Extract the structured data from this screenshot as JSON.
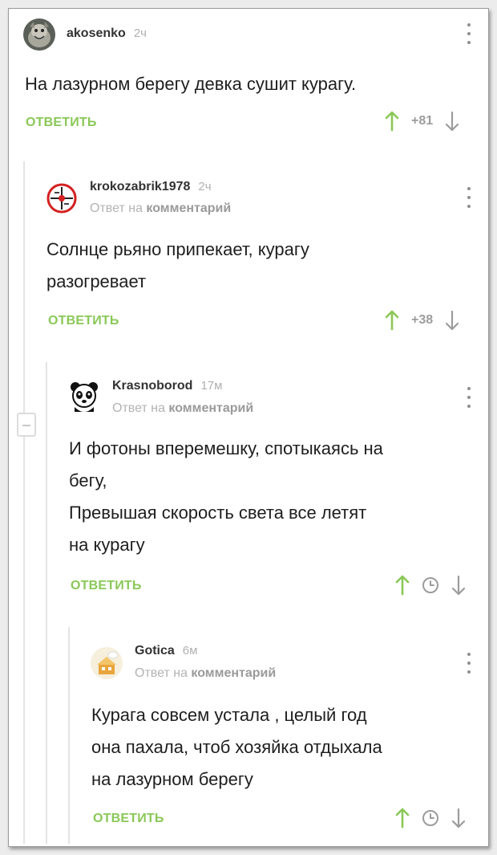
{
  "comments": [
    {
      "username": "akosenko",
      "time": "2ч",
      "text_lines": [
        "На лазурном берегу девка сушит курагу."
      ],
      "reply_label": "ОТВЕТИТЬ",
      "score": "+81"
    },
    {
      "username": "krokozabrik1978",
      "time": "2ч",
      "reply_prefix": "Ответ на",
      "reply_target": "комментарий",
      "text_lines": [
        "Солнце рьяно припекает, курагу",
        "разогревает"
      ],
      "reply_label": "ОТВЕТИТЬ",
      "score": "+38"
    },
    {
      "username": "Krasnoborod",
      "time": "17м",
      "reply_prefix": "Ответ на",
      "reply_target": "комментарий",
      "text_lines": [
        "И фотоны вперемешку, спотыкаясь на",
        "бегу,",
        "Превышая скорость света все летят",
        "на курагу"
      ],
      "reply_label": "ОТВЕТИТЬ"
    },
    {
      "username": "Gotica",
      "time": "6м",
      "reply_prefix": "Ответ на",
      "reply_target": "комментарий",
      "text_lines": [
        "Курага совсем устала , целый год",
        "она пахала, чтоб хозяйка отдыхала",
        "на лазурном берегу"
      ],
      "reply_label": "ОТВЕТИТЬ"
    }
  ],
  "icons": {
    "upvote": "arrow-up-icon",
    "downvote": "arrow-down-icon",
    "pending": "clock-icon",
    "menu": "kebab-menu-icon",
    "collapse": "collapse-thread-icon"
  },
  "colors": {
    "accent_green": "#8ac858",
    "muted": "#9c9c9c",
    "thread_line": "#e4e4e4"
  }
}
